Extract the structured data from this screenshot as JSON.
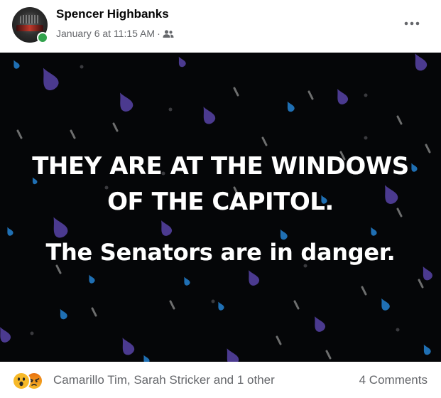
{
  "post": {
    "author": "Spencer Highbanks",
    "timestamp": "January 6 at 11:15 AM",
    "separator": "·",
    "audience_icon": "friends-icon",
    "more_icon": "more-dots-icon",
    "online_status_color": "#31a24c"
  },
  "image": {
    "background_color": "#050608",
    "text_line_1": "THEY ARE AT THE WINDOWS",
    "text_line_2": "OF THE CAPITOL.",
    "text_line_3": "The Senators are in danger.",
    "drop_colors": [
      "#4b3a8f",
      "#1f6fb3",
      "#9a9a9a"
    ]
  },
  "footer": {
    "reaction_icons": [
      "wow-emoji-icon",
      "angry-emoji-icon"
    ],
    "reactors_text": "Camarillo Tim, Sarah Stricker and 1 other",
    "comments_text": "4 Comments"
  }
}
